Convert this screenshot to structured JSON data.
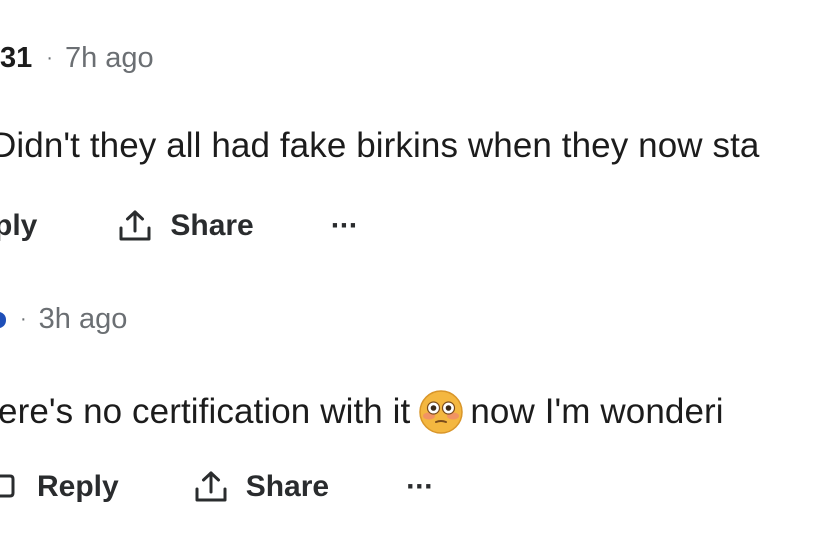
{
  "comments": [
    {
      "username": "31",
      "separator": "·",
      "timestamp": "7h ago",
      "body": "Didn't they all had fake birkins when they now sta",
      "reply_label": "ply",
      "share_label": "Share",
      "more_label": "···"
    },
    {
      "username": "",
      "separator": "·",
      "timestamp": "3h ago",
      "body_before_emoji": "ere's no certification with it",
      "emoji": "flushed-face",
      "body_after_emoji": "now I'm wonderi",
      "reply_label": "Reply",
      "share_label": "Share",
      "more_label": "···"
    }
  ],
  "colors": {
    "text": "#1c1c1c",
    "muted": "#6b6f73",
    "action": "#2a2c2e",
    "avatar_accent": "#1f4fb8",
    "emoji_face": "#f4b740"
  }
}
